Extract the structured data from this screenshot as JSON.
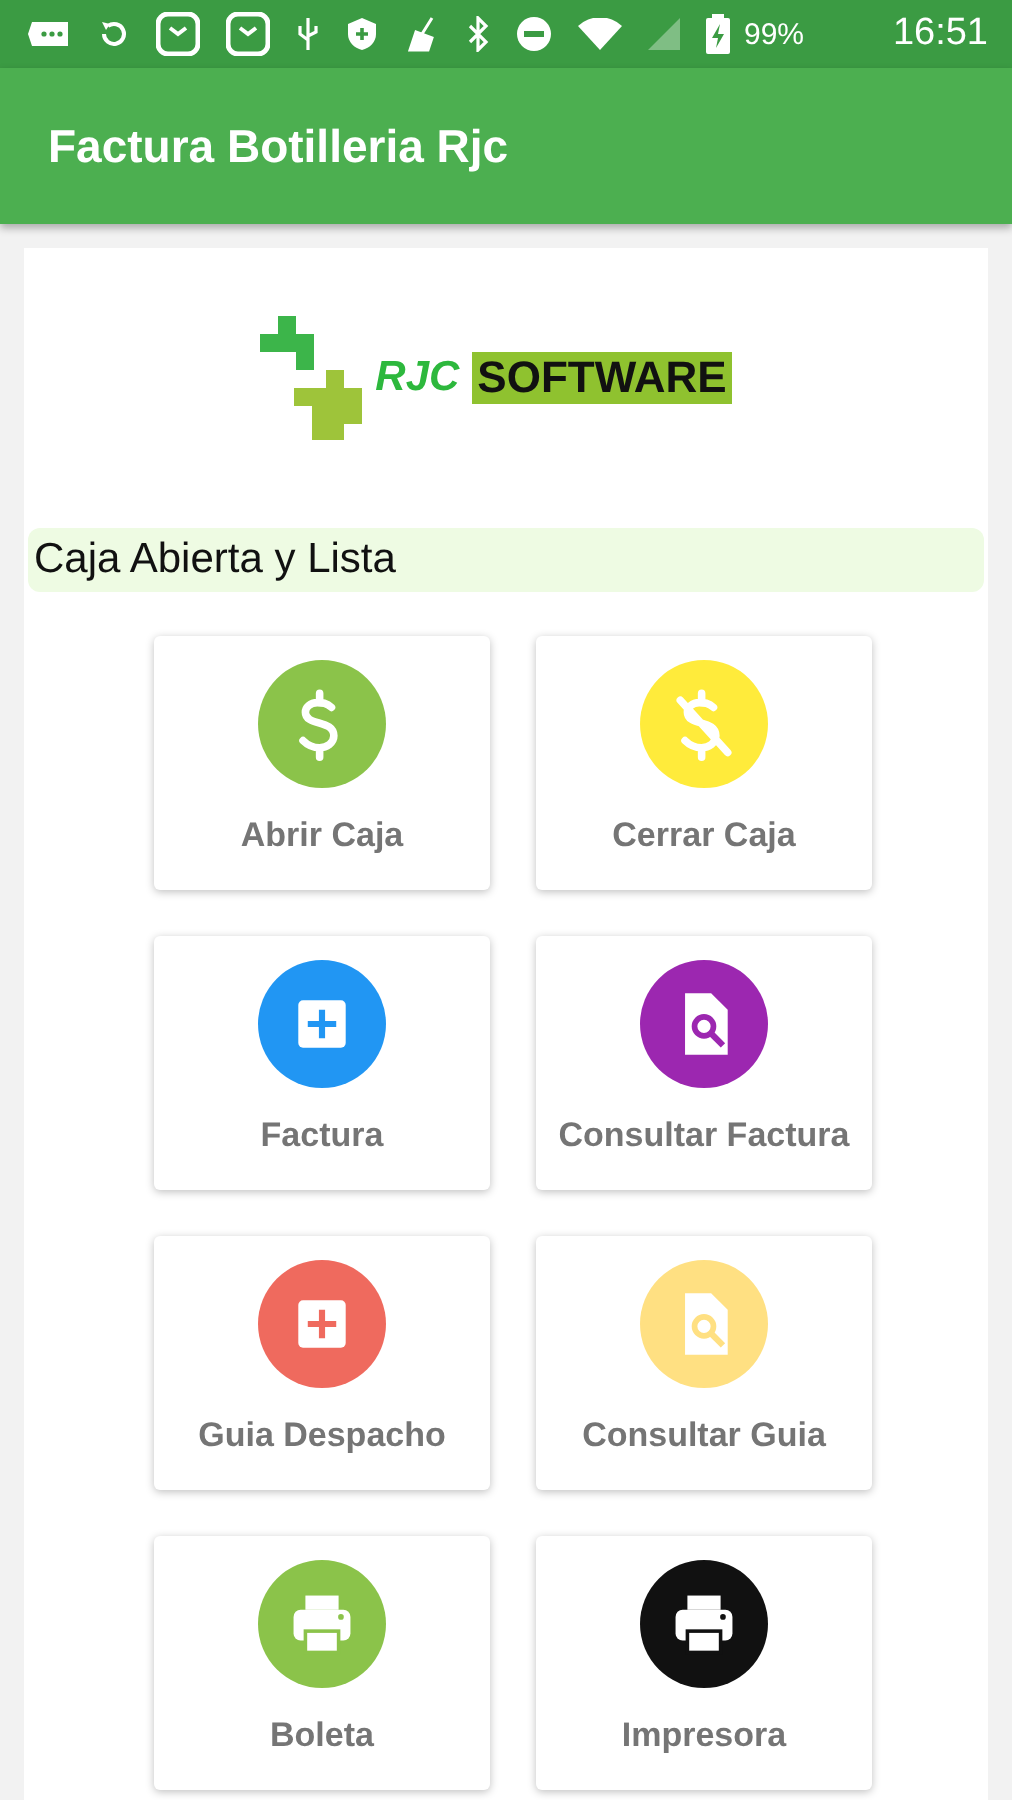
{
  "status_bar": {
    "battery": "99%",
    "time": "16:51"
  },
  "app_bar": {
    "title": "Factura Botilleria Rjc"
  },
  "logo": {
    "brand": "RJC",
    "product": "SOFTWARE"
  },
  "status_message": "Caja Abierta y Lista",
  "tiles": [
    {
      "label": "Abrir Caja",
      "kind": "dollar",
      "color": "#8bc34a"
    },
    {
      "label": "Cerrar Caja",
      "kind": "no-dollar",
      "color": "#ffeb3b"
    },
    {
      "label": "Factura",
      "kind": "add-doc",
      "color": "#2196f3"
    },
    {
      "label": "Consultar Factura",
      "kind": "search-doc",
      "color": "#9c27b0"
    },
    {
      "label": "Guia Despacho",
      "kind": "add-doc",
      "color": "#ef6a5e"
    },
    {
      "label": "Consultar Guia",
      "kind": "search-doc",
      "color": "#ffe082"
    },
    {
      "label": "Boleta",
      "kind": "printer",
      "color": "#8bc34a"
    },
    {
      "label": "Impresora",
      "kind": "printer",
      "color": "#111111"
    }
  ]
}
